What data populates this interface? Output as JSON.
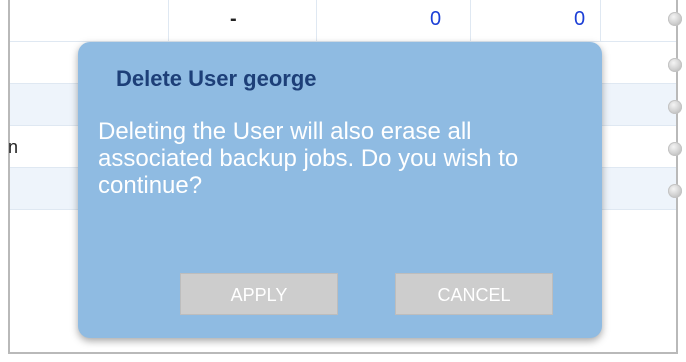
{
  "table": {
    "rows": [
      {
        "name": "",
        "dash": "-",
        "num1": "0",
        "num2": "0",
        "alt": false
      },
      {
        "name": "",
        "dash": "",
        "num1": "",
        "num2": "",
        "alt": false
      },
      {
        "name": "",
        "dash": "",
        "num1": "",
        "num2": "",
        "alt": true
      },
      {
        "name": "n",
        "dash": "",
        "num1": "",
        "num2": "",
        "alt": false
      },
      {
        "name": "",
        "dash": "",
        "num1": "",
        "num2": "",
        "alt": true
      }
    ]
  },
  "dialog": {
    "title": "Delete User george",
    "message": "Deleting the User will also erase all associated backup jobs. Do you wish to continue?",
    "apply_label": "APPLY",
    "cancel_label": "CANCEL"
  },
  "colors": {
    "dialog_bg": "#8fbbe2",
    "title": "#1d3f78",
    "button_bg": "#cdcdcd",
    "link_number": "#1c3fd6"
  }
}
